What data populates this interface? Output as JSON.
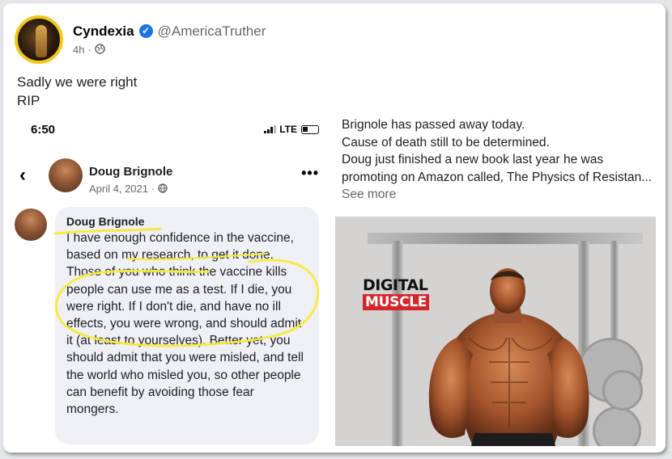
{
  "post": {
    "author_name": "Cyndexia",
    "author_handle": "@AmericaTruther",
    "time_ago": "4h",
    "separator": "·",
    "caption_line1": "Sadly we were right",
    "caption_line2": "RIP"
  },
  "embedded_phone": {
    "status_time": "6:50",
    "network": "LTE",
    "page_name": "Doug Brignole",
    "page_date": "April 4, 2021 ·",
    "comment_author": "Doug Brignole",
    "comment_text": "I have enough confidence in the vaccine, based on my research, to get it done. Those of you who think the vaccine kills people can use me as a test. If I die, you were right. If I don't die, and have no ill effects, you were wrong, and should admit it (at least to yourselves). Better yet, you should admit that you were misled, and tell the world who misled you, so other people can benefit by avoiding those fear mongers."
  },
  "right_post": {
    "line1": "Brignole has passed away today.",
    "line2": "Cause of death still to be determined.",
    "line3": "Doug just finished a new book last year he was promoting on Amazon called, The Physics of Resistan...",
    "see_more": "See more",
    "logo_top": "DIGITAL",
    "logo_bottom": "MUSCLE"
  },
  "colors": {
    "verified_blue": "#1b74e4",
    "highlighter_yellow": "#f5ea3a",
    "logo_red": "#d4262a",
    "avatar_ring": "#f2c81a"
  },
  "icons": [
    "verified-icon",
    "public-audience-icon",
    "signal-icon",
    "battery-icon",
    "back-arrow-icon",
    "globe-icon",
    "more-options-icon"
  ]
}
